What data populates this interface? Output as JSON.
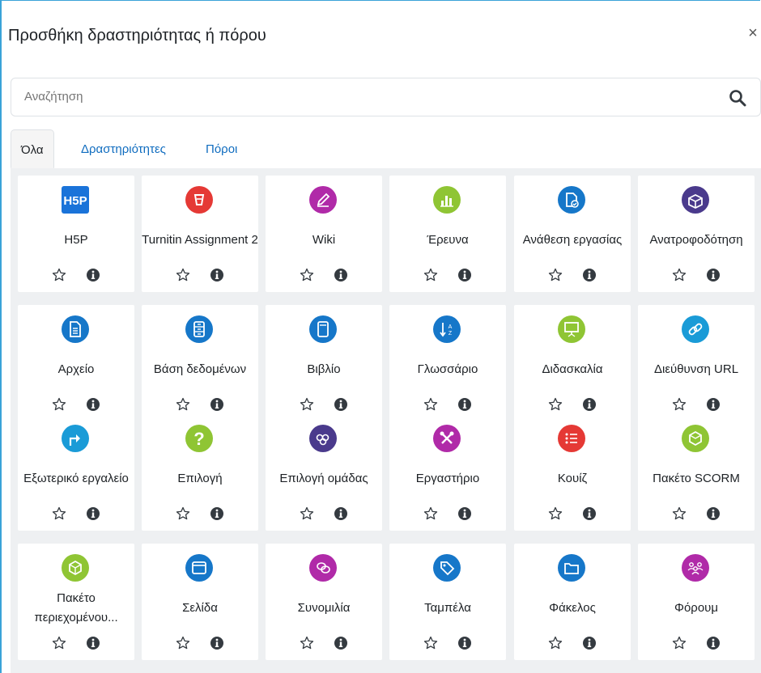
{
  "dialog": {
    "title": "Προσθήκη δραστηριότητας ή πόρου",
    "close_symbol": "×"
  },
  "search": {
    "placeholder": "Αναζήτηση"
  },
  "tabs": [
    {
      "label": "Όλα",
      "active": true
    },
    {
      "label": "Δραστηριότητες",
      "active": false
    },
    {
      "label": "Πόροι",
      "active": false
    }
  ],
  "items": [
    {
      "label": "H5P",
      "icon": "h5p-icon",
      "color": "#1a73d9"
    },
    {
      "label": "Turnitin Assignment 2",
      "icon": "turnitin-icon",
      "color": "#e53935"
    },
    {
      "label": "Wiki",
      "icon": "pencil-icon",
      "color": "#b02aa8"
    },
    {
      "label": "Έρευνα",
      "icon": "bar-chart-icon",
      "color": "#8fc534"
    },
    {
      "label": "Ανάθεση εργασίας",
      "icon": "assignment-icon",
      "color": "#1677c9"
    },
    {
      "label": "Ανατροφοδότηση",
      "icon": "feedback-box-icon",
      "color": "#4a3a8c"
    },
    {
      "label": "Αρχείο",
      "icon": "file-icon",
      "color": "#1677c9"
    },
    {
      "label": "Βάση δεδομένων",
      "icon": "database-icon",
      "color": "#1677c9"
    },
    {
      "label": "Βιβλίο",
      "icon": "book-icon",
      "color": "#1677c9"
    },
    {
      "label": "Γλωσσάριο",
      "icon": "glossary-sort-icon",
      "color": "#1677c9"
    },
    {
      "label": "Διδασκαλία",
      "icon": "presentation-icon",
      "color": "#8fc534"
    },
    {
      "label": "Διεύθυνση URL",
      "icon": "link-icon",
      "color": "#1a9bd7"
    },
    {
      "label": "Εξωτερικό εργαλείο",
      "icon": "external-tool-icon",
      "color": "#1a9bd7"
    },
    {
      "label": "Επιλογή",
      "icon": "question-icon",
      "color": "#8fc534"
    },
    {
      "label": "Επιλογή ομάδας",
      "icon": "group-choice-icon",
      "color": "#4a3a8c"
    },
    {
      "label": "Εργαστήριο",
      "icon": "tools-icon",
      "color": "#b02aa8"
    },
    {
      "label": "Κουίζ",
      "icon": "quiz-list-icon",
      "color": "#e53935"
    },
    {
      "label": "Πακέτο SCORM",
      "icon": "scorm-package-icon",
      "color": "#8fc534"
    },
    {
      "label": "Πακέτο περιεχομένου...",
      "icon": "content-package-icon",
      "color": "#8fc534"
    },
    {
      "label": "Σελίδα",
      "icon": "page-icon",
      "color": "#1677c9"
    },
    {
      "label": "Συνομιλία",
      "icon": "chat-icon",
      "color": "#b02aa8"
    },
    {
      "label": "Ταμπέλα",
      "icon": "label-tag-icon",
      "color": "#1677c9"
    },
    {
      "label": "Φάκελος",
      "icon": "folder-icon",
      "color": "#1677c9"
    },
    {
      "label": "Φόρουμ",
      "icon": "forum-icon",
      "color": "#b02aa8"
    }
  ]
}
